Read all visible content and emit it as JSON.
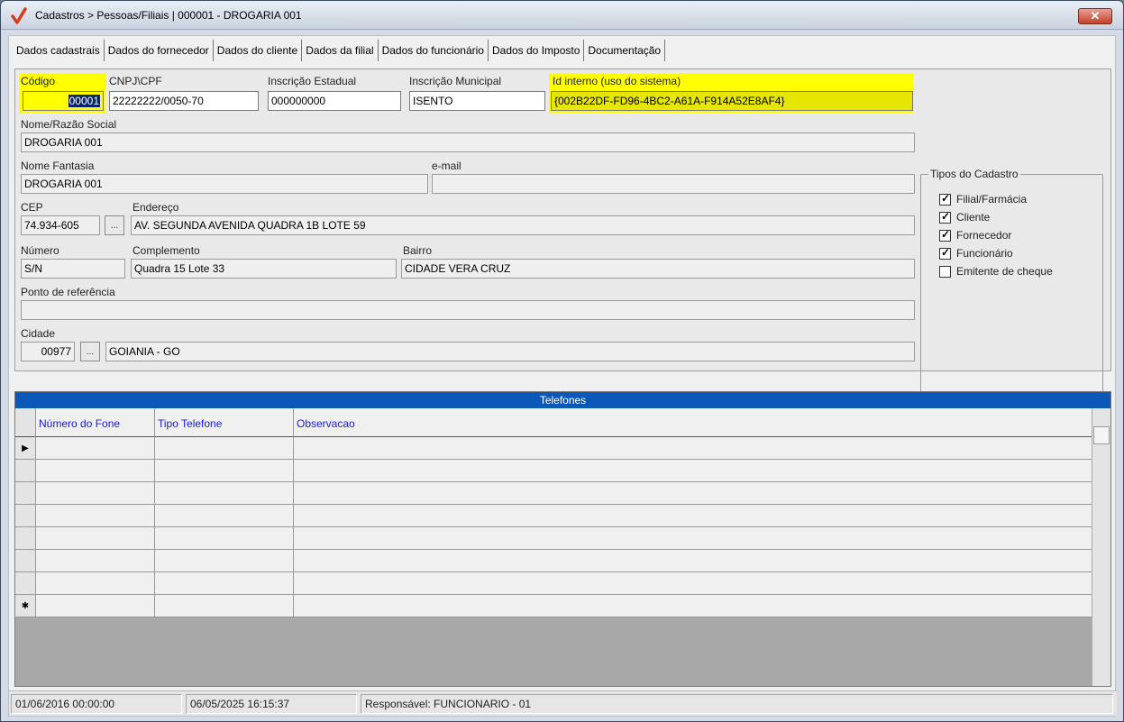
{
  "window": {
    "title": "Cadastros > Pessoas/Filiais | 000001 - DROGARIA 001",
    "close_label": "✕"
  },
  "tabs": [
    "Dados cadastrais",
    "Dados do fornecedor",
    "Dados do cliente",
    "Dados da filial",
    "Dados do funcionário",
    "Dados do Imposto",
    "Documentação"
  ],
  "form": {
    "codigo": {
      "label": "Código",
      "value": "00001"
    },
    "cnpj": {
      "label": "CNPJ\\CPF",
      "value": "22222222/0050-70"
    },
    "inscricao_estadual": {
      "label": "Inscrição Estadual",
      "value": "000000000"
    },
    "inscricao_municipal": {
      "label": "Inscrição Municipal",
      "value": "ISENTO"
    },
    "id_interno": {
      "label": "Id interno (uso do sistema)",
      "value": "{002B22DF-FD96-4BC2-A61A-F914A52E8AF4}"
    },
    "razao_social": {
      "label": "Nome/Razão Social",
      "value": "DROGARIA 001"
    },
    "nome_fantasia": {
      "label": "Nome Fantasia",
      "value": "DROGARIA 001"
    },
    "email": {
      "label": "e-mail",
      "value": ""
    },
    "cep": {
      "label": "CEP",
      "value": "74.934-605"
    },
    "endereco": {
      "label": "Endereço",
      "value": "AV. SEGUNDA AVENIDA QUADRA 1B  LOTE 59"
    },
    "numero": {
      "label": "Número",
      "value": "S/N"
    },
    "complemento": {
      "label": "Complemento",
      "value": "Quadra 15 Lote 33"
    },
    "bairro": {
      "label": "Bairro",
      "value": "CIDADE VERA CRUZ"
    },
    "ponto_referencia": {
      "label": "Ponto de referência",
      "value": ""
    },
    "cidade": {
      "label": "Cidade",
      "code": "00977",
      "name": "GOIANIA - GO"
    },
    "dots_label": "..."
  },
  "tipos_cadastro": {
    "title": "Tipos do Cadastro",
    "items": [
      {
        "label": "Filial/Farmácia",
        "checked": true
      },
      {
        "label": "Cliente",
        "checked": true
      },
      {
        "label": "Fornecedor",
        "checked": true
      },
      {
        "label": "Funcionário",
        "checked": true
      },
      {
        "label": "Emitente de cheque",
        "checked": false
      }
    ]
  },
  "telefones": {
    "caption": "Telefones",
    "columns": [
      "Número do Fone",
      "Tipo Telefone",
      "Observacao"
    ],
    "current_row_marker": "▶",
    "new_row_marker": "✱"
  },
  "status": {
    "created": "01/06/2016 00:00:00",
    "modified": "06/05/2025 16:15:37",
    "responsavel": "Responsável: FUNCIONARIO - 01"
  },
  "colors": {
    "highlight_yellow": "#ffff00",
    "grid_caption_blue": "#0a58b8",
    "column_header_text": "#1a1ad0"
  }
}
